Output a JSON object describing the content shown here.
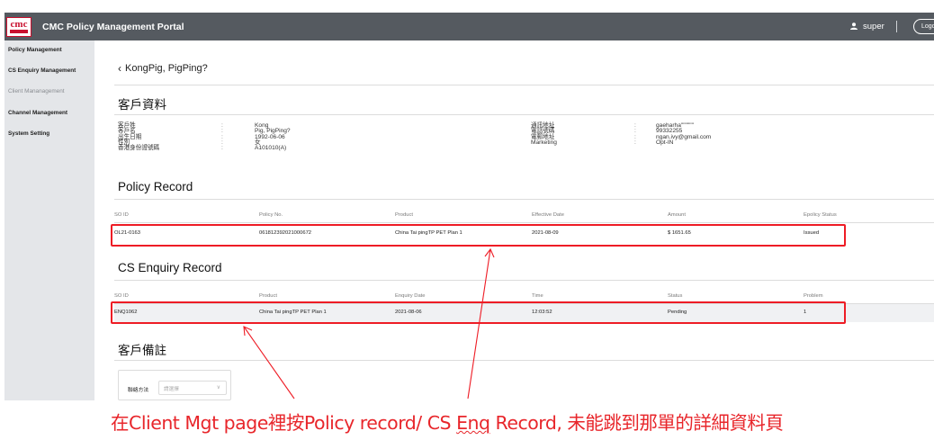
{
  "header": {
    "logo_text": "cmc",
    "app_title": "CMC Policy Management Portal",
    "user_icon": "user-icon",
    "username": "super",
    "logout_label": "Logout"
  },
  "sidebar": {
    "items": [
      {
        "label": "Policy Management"
      },
      {
        "label": "CS Enquiry Management"
      },
      {
        "label": "Client Mananagement"
      },
      {
        "label": "Channel Management"
      },
      {
        "label": "System Setting"
      }
    ]
  },
  "page": {
    "back_icon": "chevron-left-icon",
    "client_name": "KongPig, PigPing?"
  },
  "client_info": {
    "title": "客戶資料",
    "left_labels": [
      "客戶姓",
      "客戶名",
      "出生日期",
      "性別",
      "香港身份證號碼"
    ],
    "left_values": [
      "Kong",
      "Pig, PigPing?",
      "1992-06-06",
      "女",
      "A101010(A)"
    ],
    "right_labels": [
      "通訊地址",
      "電話號碼",
      "電郵地址",
      "Marketing"
    ],
    "right_values": [
      "gaeharha\"\"\"\"\"\"",
      "99332255",
      "ngan.ivy@gmail.com",
      "Opt-IN"
    ]
  },
  "policy_record": {
    "title": "Policy Record",
    "headers": [
      "SO ID",
      "Policy No.",
      "Product",
      "Effective Date",
      "Amount",
      "Epolicy Status"
    ],
    "rows": [
      [
        "OL21-0163",
        "061812392021000672",
        "China Tai pingTP PET Plan 1",
        "2021-08-09",
        "$ 1651.65",
        "Issued"
      ]
    ]
  },
  "cs_enquiry_record": {
    "title": "CS Enquiry Record",
    "headers": [
      "SO ID",
      "Product",
      "Enquiry Date",
      "Time",
      "Status",
      "Problem"
    ],
    "rows": [
      [
        "ENQ1062",
        "China Tai pingTP PET Plan 1",
        "2021-08-06",
        "12:03:52",
        "Pending",
        "1"
      ]
    ]
  },
  "client_notes": {
    "title": "客戶備註",
    "contact_method_label": "聯絡方法",
    "contact_method_placeholder": "請選擇"
  },
  "annotation": {
    "text_before": "在Client Mgt page裡按Policy record/ CS ",
    "text_underlined": "Enq",
    "text_after": " Record, 未能跳到那單的詳細資料頁",
    "color": "#e8262b"
  },
  "colors": {
    "topbar": "#555a60",
    "sidebar": "#e4e6e9",
    "highlight_red": "#ee1c25"
  }
}
